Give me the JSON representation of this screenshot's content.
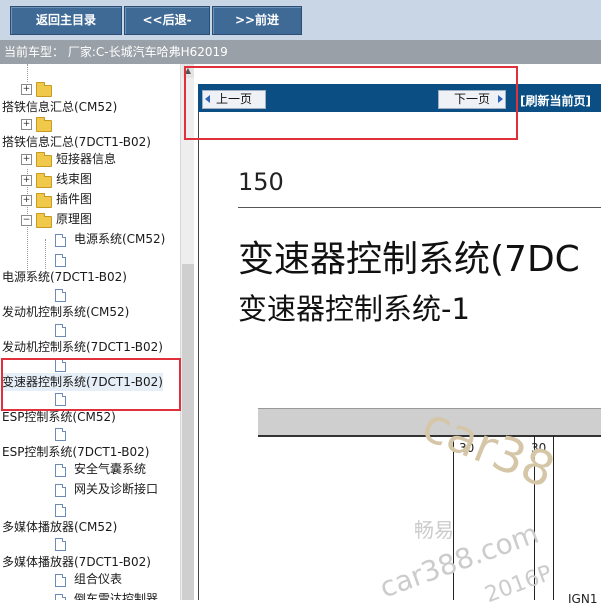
{
  "toolbar": {
    "back_main": "返回主目录",
    "back": "<<后退-",
    "forward": ">>前进"
  },
  "status": {
    "vehicle": "当前车型：  厂家:C-长城汽车哈弗H62019"
  },
  "sidebar": {
    "items": [
      {
        "label": "搭铁信息汇总(CM52)"
      },
      {
        "label": "搭铁信息汇总(7DCT1-B02)"
      },
      {
        "label": "短接器信息"
      },
      {
        "label": "线束图"
      },
      {
        "label": "插件图"
      },
      {
        "label": "原理图"
      },
      {
        "label": "电源系统(CM52)"
      },
      {
        "label": "电源系统(7DCT1-B02)"
      },
      {
        "label": "发动机控制系统(CM52)"
      },
      {
        "label": "发动机控制系统(7DCT1-B02)"
      },
      {
        "label": "变速器控制系统(7DCT1-B02)"
      },
      {
        "label": "ESP控制系统(CM52)"
      },
      {
        "label": "ESP控制系统(7DCT1-B02)"
      },
      {
        "label": "安全气囊系统"
      },
      {
        "label": "网关及诊断接口"
      },
      {
        "label": "多媒体播放器(CM52)"
      },
      {
        "label": "多媒体播放器(7DCT1-B02)"
      },
      {
        "label": "组合仪表"
      },
      {
        "label": "倒车雷达控制器"
      }
    ]
  },
  "nav": {
    "prev": "上一页",
    "next": "下一页",
    "refresh": "[刷新当前页]"
  },
  "content": {
    "page_number": "150",
    "title": "变速器控制系统(7DC",
    "subtitle": "变速器控制系统-1",
    "diagram_labels": [
      "30",
      "30",
      "IGN1"
    ]
  },
  "watermark": {
    "site1": "car38",
    "brand": "畅易",
    "site2": "car388.com",
    "year": "2016P"
  },
  "colors": {
    "toolbar_button": "#3f6a96",
    "nav_bar": "#0b4e84",
    "highlight": "#e0303a"
  }
}
